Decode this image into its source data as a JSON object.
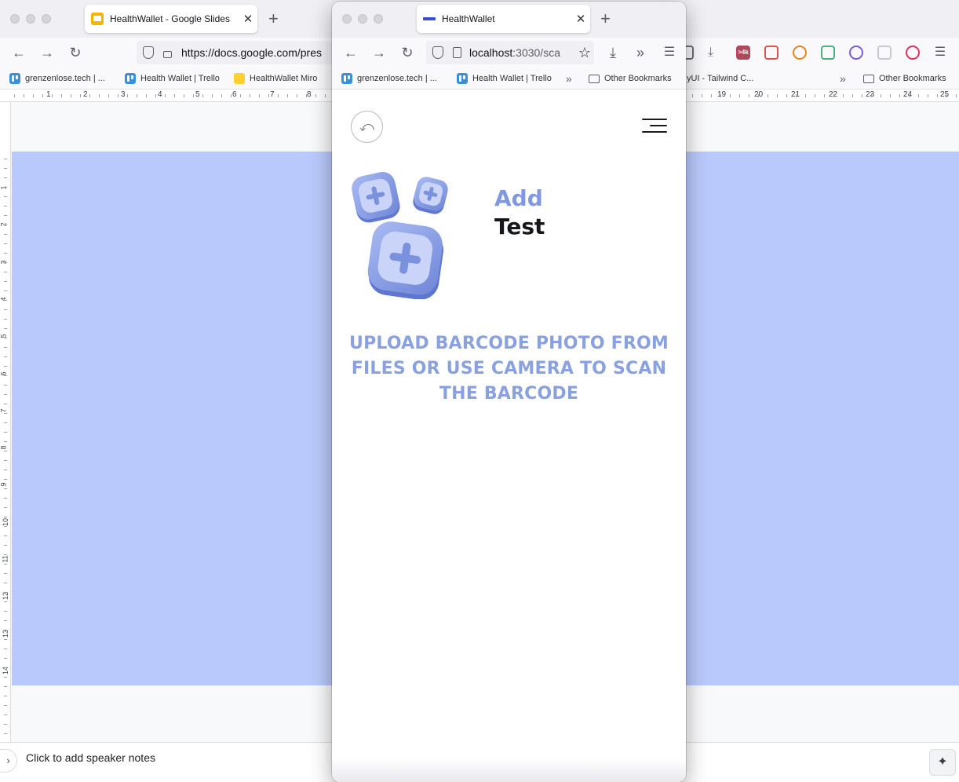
{
  "background_browser": {
    "tab": {
      "title": "HealthWallet - Google Slides"
    },
    "url": {
      "host": "https://docs.google.com/pres"
    },
    "bookmarks": [
      {
        "label": "grenzenlose.tech | ..."
      },
      {
        "label": "Health Wallet | Trello"
      },
      {
        "label": "HealthWallet Miro"
      },
      {
        "label": "yUI - Tailwind C..."
      },
      {
        "label": "Other Bookmarks"
      }
    ],
    "extensions": [
      {
        "name": "shield-extension-icon",
        "color": "#6b6b75"
      },
      {
        "name": "download-icon",
        "color": "#6b6b75"
      },
      {
        "name": "4k-extension-icon",
        "color": "#b0475a",
        "badge": ">4k"
      },
      {
        "name": "dots-extension-icon",
        "color": "#d9534f"
      },
      {
        "name": "metamask-icon",
        "color": "#e8831d"
      },
      {
        "name": "green-shield-extension-icon",
        "color": "#4caf7a"
      },
      {
        "name": "purple-circle-extension-icon",
        "color": "#7b5cd6"
      },
      {
        "name": "grid-extension-icon",
        "color": "#c8c8d0"
      },
      {
        "name": "red-shield-extension-icon",
        "color": "#e0315a"
      }
    ],
    "ruler_top": [
      "1",
      "2",
      "3",
      "4",
      "5",
      "6",
      "7",
      "8",
      "19",
      "20",
      "21",
      "22",
      "23",
      "24",
      "25"
    ],
    "ruler_left": [
      "1",
      "2",
      "3",
      "4",
      "5",
      "6",
      "7",
      "8",
      "9",
      "10",
      "11",
      "12",
      "13",
      "14"
    ],
    "speaker_notes": "Click to add speaker notes",
    "slide_color": "#b9c9fb"
  },
  "foreground_browser": {
    "tab": {
      "title": "HealthWallet"
    },
    "url": {
      "host": "localhost",
      "rest": ":3030/sca"
    },
    "bookmarks": [
      {
        "label": "grenzenlose.tech | ..."
      },
      {
        "label": "Health Wallet | Trello"
      },
      {
        "label": "Other Bookmarks"
      }
    ],
    "app": {
      "title_line1": "Add",
      "title_line2": "Test",
      "instructions": "UPLOAD BARCODE PHOTO FROM FILES OR USE CAMERA TO SCAN THE BARCODE",
      "accent_color": "#7f98e0"
    }
  }
}
